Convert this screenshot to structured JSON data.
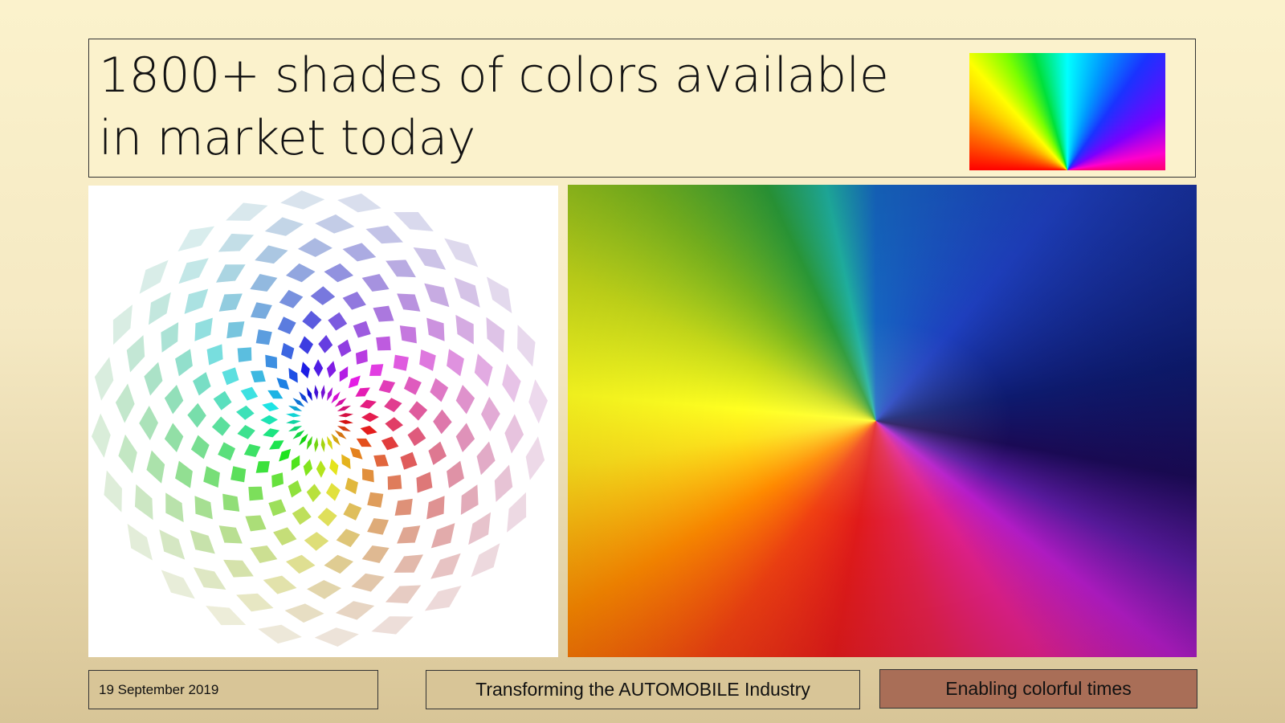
{
  "slide": {
    "title": "1800+ shades of colors available\nin market today"
  },
  "images": {
    "thumbnail_icon": "rainbow-fan-image",
    "left_icon": "color-wheel-flower-image",
    "right_icon": "rainbow-burst-image"
  },
  "footer": {
    "date": "19 September 2019",
    "center_text": "Transforming the AUTOMOBILE Industry",
    "tagline": "Enabling colorful times"
  },
  "colors": {
    "background": "#fbf2cc",
    "tag_background": "#a96e57",
    "border": "#333333"
  }
}
